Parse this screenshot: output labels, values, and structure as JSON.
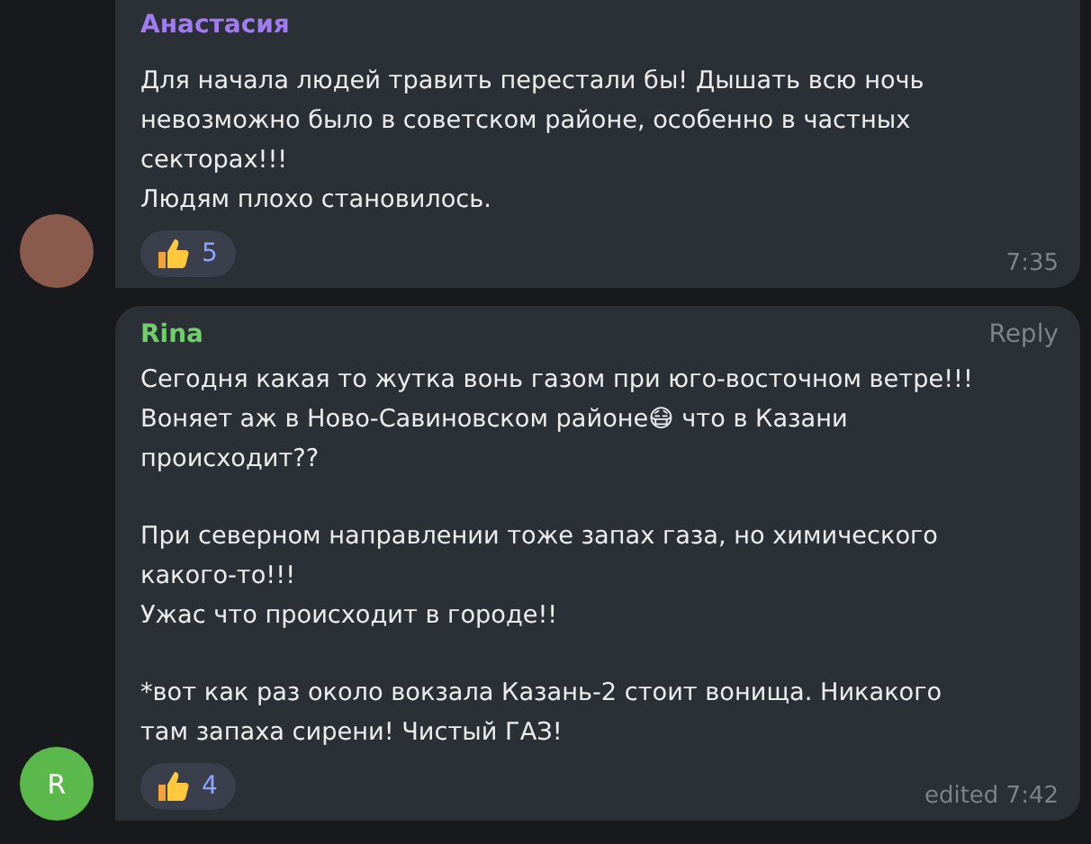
{
  "messages": [
    {
      "author": "Анастасия",
      "color": "#a07cf0",
      "avatar": {
        "kind": "photo"
      },
      "paragraphs": [
        [
          "Для начала людей травить перестали бы! Дышать всю ночь",
          "невозможно было в советском районе, особенно в частных",
          "секторах!!!",
          "Людям плохо становилось."
        ]
      ],
      "reaction": {
        "count": "5"
      },
      "time": "7:35"
    },
    {
      "author": "Rina",
      "color": "#6fcf6a",
      "avatar": {
        "kind": "initial",
        "letter": "R",
        "color": "#5bb84a"
      },
      "reply": "Reply",
      "paragraphs": [
        [
          "Сегодня какая то жутка вонь газом при юго-восточном ветре!!!",
          "Воняет аж в Ново-Савиновском районе😷 что в Казани",
          "происходит??"
        ],
        [
          "При северном направлении тоже запах газа, но химического",
          "какого-то!!!",
          "Ужас что происходит в городе!!"
        ],
        [
          "*вот как раз около вокзала Казань-2 стоит вонища. Никакого",
          "там запаха сирени! Чистый ГАЗ!"
        ]
      ],
      "reaction": {
        "count": "4"
      },
      "time": "edited 7:42"
    }
  ]
}
